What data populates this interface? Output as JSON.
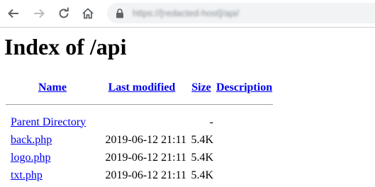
{
  "browser": {
    "url_obscured": "https://[redacted-host]/api/"
  },
  "page": {
    "heading": "Index of /api",
    "columns": {
      "name": "Name",
      "last_modified": "Last modified",
      "size": "Size",
      "description": "Description"
    },
    "parent": {
      "name": "Parent Directory",
      "size": "-"
    },
    "files": [
      {
        "name": "back.php",
        "modified": "2019-06-12 21:11",
        "size": "5.4K"
      },
      {
        "name": "logo.php",
        "modified": "2019-06-12 21:11",
        "size": "5.4K"
      },
      {
        "name": "txt.php",
        "modified": "2019-06-12 21:11",
        "size": "5.4K"
      }
    ]
  },
  "colors": {
    "link": "#0000ee",
    "omnibox_bg": "#f1f3f4"
  }
}
